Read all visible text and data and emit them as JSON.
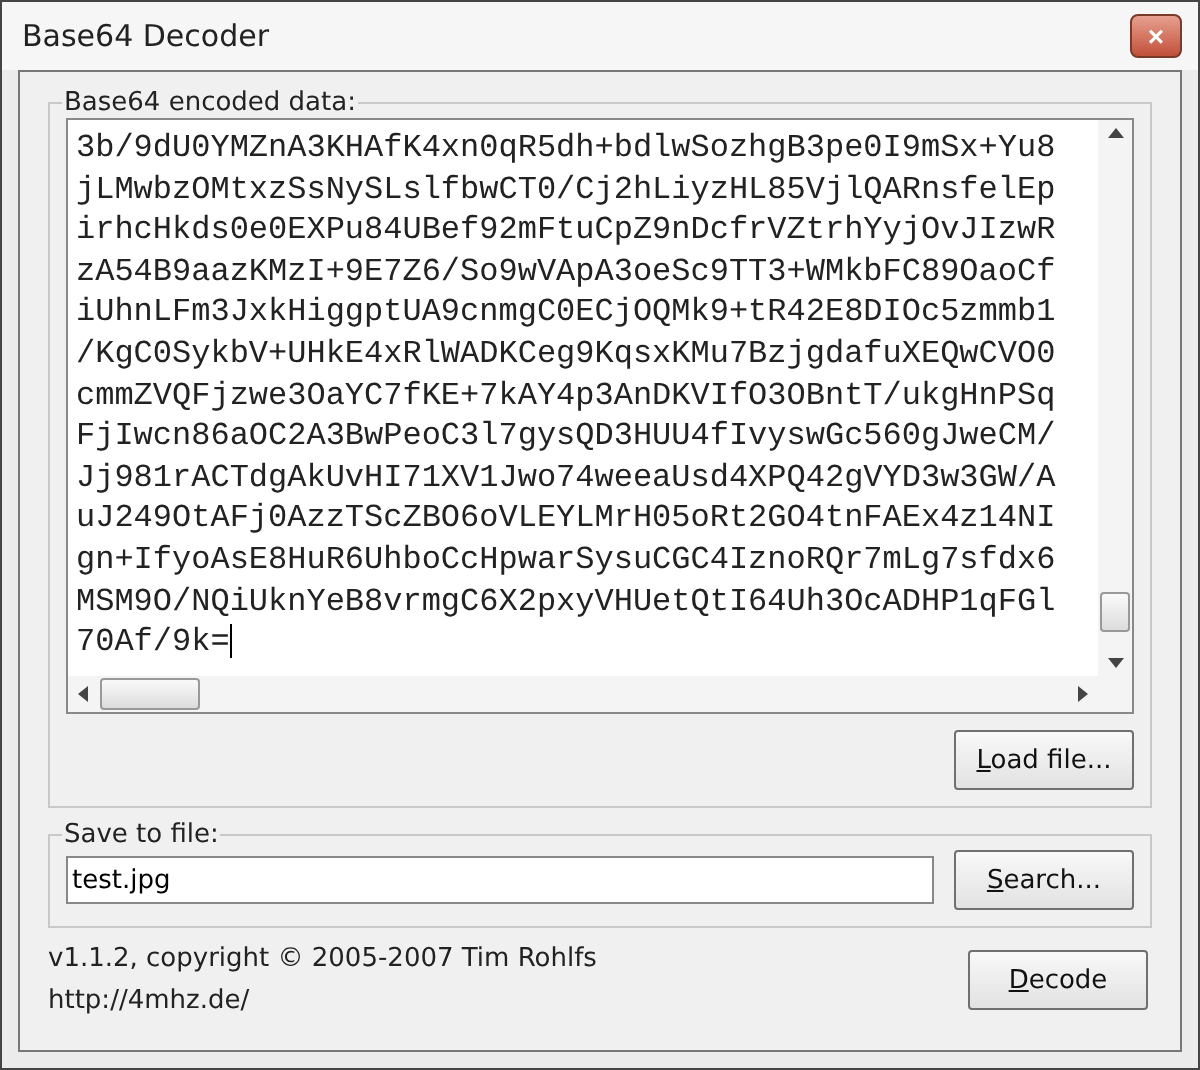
{
  "window": {
    "title": "Base64 Decoder",
    "close": "×"
  },
  "encoded": {
    "label": "Base64 encoded data:",
    "lines": [
      "3b/9dU0YMZnA3KHAfK4xn0qR5dh+bdlwSozhgB3pe0I9mSx+Yu8",
      "jLMwbzOMtxzSsNySLslfbwCT0/Cj2hLiyzHL85VjlQARnsfelEp",
      "irhcHkds0e0EXPu84UBef92mFtuCpZ9nDcfrVZtrhYyjOvJIzwR",
      "zA54B9aazKMzI+9E7Z6/So9wVApA3oeSc9TT3+WMkbFC89OaoCf",
      "iUhnLFm3JxkHiggptUA9cnmgC0ECjOQMk9+tR42E8DIOc5zmmb1",
      "/KgC0SykbV+UHkE4xRlWADKCeg9KqsxKMu7BzjgdafuXEQwCVO0",
      "cmmZVQFjzwe3OaYC7fKE+7kAY4p3AnDKVIfO3OBntT/ukgHnPSq",
      "FjIwcn86aOC2A3BwPeoC3l7gysQD3HUU4fIvyswGc560gJweCM/",
      "Jj981rACTdgAkUvHI71XV1Jwo74weeaUsd4XPQ42gVYD3w3GW/A",
      "uJ249OtAFj0AzzTScZBO6oVLEYLMrH05oRt2GO4tnFAEx4z14NI",
      "gn+IfyoAsE8HuR6UhboCcHpwarSysuCGC4IznoRQr7mLg7sfdx6",
      "MSM9O/NQiUknYeB8vrmgC6X2pxyVHUetQtI64Uh3OcADHP1qFGl",
      "70Af/9k="
    ],
    "load_button": "Load file..."
  },
  "save": {
    "label": "Save to file:",
    "value": "test.jpg",
    "search_button": "Search..."
  },
  "footer": {
    "copyright": "v1.1.2, copyright © 2005-2007 Tim Rohlfs",
    "url": "http://4mhz.de/",
    "decode_button": "Decode"
  }
}
